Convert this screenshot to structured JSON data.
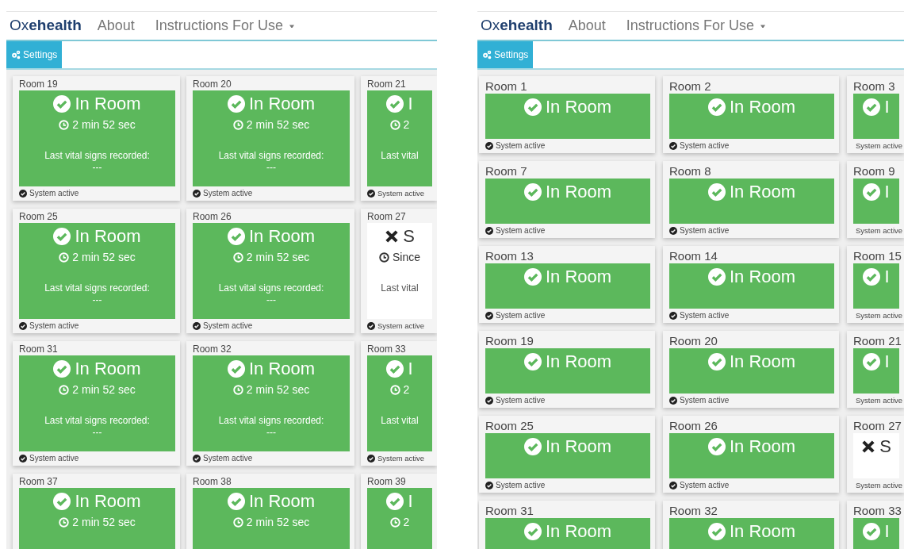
{
  "panels": [
    {
      "brand": "Ox**ehealth**",
      "nav": [
        {
          "label": "About",
          "dropdown": false
        },
        {
          "label": "Instructions For Use",
          "dropdown": true
        }
      ],
      "settings_button": "Settings",
      "detailed": true,
      "rooms": [
        {
          "name": "Room 19",
          "kind": "present",
          "status": "In Room",
          "timer": "2 min 52 sec",
          "vitals_label": "Last vital signs recorded:",
          "vitals_value": "---",
          "system": "System active"
        },
        {
          "name": "Room 20",
          "kind": "present",
          "status": "In Room",
          "timer": "2 min 52 sec",
          "vitals_label": "Last vital signs recorded:",
          "vitals_value": "---",
          "system": "System active"
        },
        {
          "name": "Room 21",
          "kind": "present",
          "status": "I",
          "timer": "2",
          "vitals_label": "Last vital",
          "system": "System active"
        },
        {
          "name": "Room 25",
          "kind": "present",
          "status": "In Room",
          "timer": "2 min 52 sec",
          "vitals_label": "Last vital signs recorded:",
          "vitals_value": "---",
          "system": "System active"
        },
        {
          "name": "Room 26",
          "kind": "present",
          "status": "In Room",
          "timer": "2 min 52 sec",
          "vitals_label": "Last vital signs recorded:",
          "vitals_value": "---",
          "system": "System active"
        },
        {
          "name": "Room 27",
          "kind": "absent",
          "status": "S",
          "timer": "Since",
          "vitals_label": "Last vital",
          "system": "System active"
        },
        {
          "name": "Room 31",
          "kind": "present",
          "status": "In Room",
          "timer": "2 min 52 sec",
          "vitals_label": "Last vital signs recorded:",
          "vitals_value": "---",
          "system": "System active"
        },
        {
          "name": "Room 32",
          "kind": "present",
          "status": "In Room",
          "timer": "2 min 52 sec",
          "vitals_label": "Last vital signs recorded:",
          "vitals_value": "---",
          "system": "System active"
        },
        {
          "name": "Room 33",
          "kind": "present",
          "status": "I",
          "timer": "2",
          "vitals_label": "Last vital",
          "system": "System active"
        },
        {
          "name": "Room 37",
          "kind": "present",
          "status": "In Room",
          "timer": "2 min 52 sec"
        },
        {
          "name": "Room 38",
          "kind": "present",
          "status": "In Room",
          "timer": "2 min 52 sec"
        },
        {
          "name": "Room 39",
          "kind": "present",
          "status": "I",
          "timer": "2"
        }
      ]
    },
    {
      "brand": "Ox**ehealth**",
      "nav": [
        {
          "label": "About",
          "dropdown": false
        },
        {
          "label": "Instructions For Use",
          "dropdown": true
        }
      ],
      "settings_button": "Settings",
      "detailed": false,
      "rooms": [
        {
          "name": "Room 1",
          "kind": "present",
          "status": "In Room",
          "system": "System active"
        },
        {
          "name": "Room 2",
          "kind": "present",
          "status": "In Room",
          "system": "System active"
        },
        {
          "name": "Room 3",
          "kind": "present",
          "status": "I",
          "system": "System active"
        },
        {
          "name": "Room 7",
          "kind": "present",
          "status": "In Room",
          "system": "System active"
        },
        {
          "name": "Room 8",
          "kind": "present",
          "status": "In Room",
          "system": "System active"
        },
        {
          "name": "Room 9",
          "kind": "present",
          "status": "I",
          "system": "System active"
        },
        {
          "name": "Room 13",
          "kind": "present",
          "status": "In Room",
          "system": "System active"
        },
        {
          "name": "Room 14",
          "kind": "present",
          "status": "In Room",
          "system": "System active"
        },
        {
          "name": "Room 15",
          "kind": "present",
          "status": "I",
          "system": "System active"
        },
        {
          "name": "Room 19",
          "kind": "present",
          "status": "In Room",
          "system": "System active"
        },
        {
          "name": "Room 20",
          "kind": "present",
          "status": "In Room",
          "system": "System active"
        },
        {
          "name": "Room 21",
          "kind": "present",
          "status": "I",
          "system": "System active"
        },
        {
          "name": "Room 25",
          "kind": "present",
          "status": "In Room",
          "system": "System active"
        },
        {
          "name": "Room 26",
          "kind": "present",
          "status": "In Room",
          "system": "System active"
        },
        {
          "name": "Room 27",
          "kind": "absent",
          "status": "S",
          "system": "System active"
        },
        {
          "name": "Room 31",
          "kind": "present",
          "status": "In Room"
        },
        {
          "name": "Room 32",
          "kind": "present",
          "status": "In Room"
        },
        {
          "name": "Room 33",
          "kind": "present",
          "status": "I"
        }
      ]
    }
  ]
}
